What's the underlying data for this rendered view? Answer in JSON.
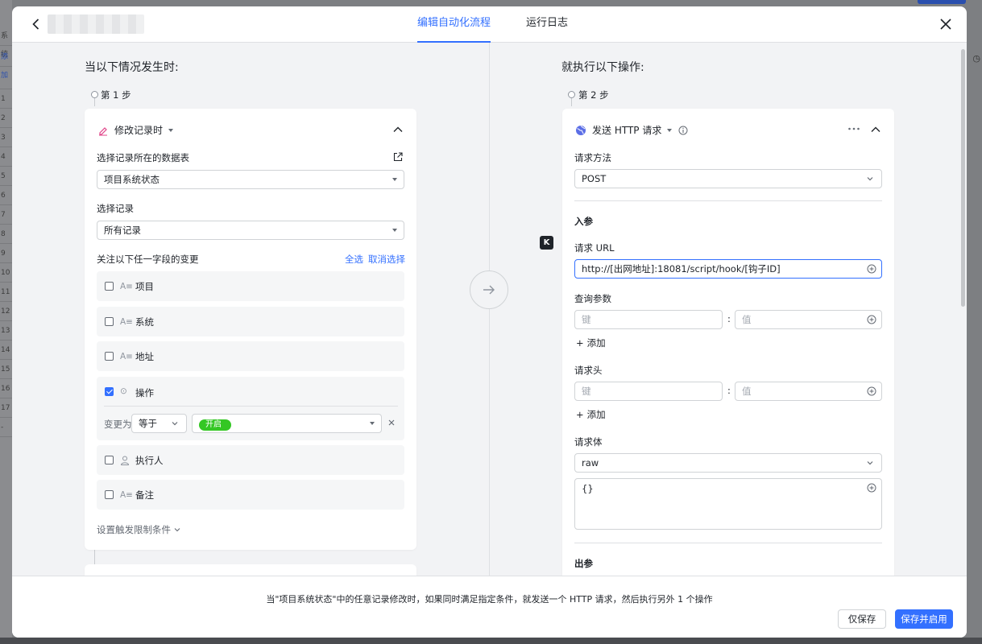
{
  "background": {
    "left_labels": [
      "系统",
      "添加",
      "",
      "1",
      "2",
      "3",
      "4",
      "5",
      "6",
      "7",
      "8",
      "9",
      "10",
      "11",
      "12",
      "13",
      "14",
      "15",
      "16",
      "17",
      "-"
    ]
  },
  "header": {
    "tabs": [
      "编辑自动化流程",
      "运行日志"
    ],
    "active_tab": "编辑自动化流程"
  },
  "trigger": {
    "section_title": "当以下情况发生时:",
    "step": "第 1 步",
    "type_label": "修改记录时",
    "table_label": "选择记录所在的数据表",
    "table_value": "项目系统状态",
    "record_label": "选择记录",
    "record_value": "所有记录",
    "fields_label": "关注以下任一字段的变更",
    "select_all": "全选",
    "deselect": "取消选择",
    "fields": [
      {
        "name": "项目",
        "type": "A≡",
        "checked": false
      },
      {
        "name": "系统",
        "type": "A≡",
        "checked": false
      },
      {
        "name": "地址",
        "type": "A≡",
        "checked": false
      },
      {
        "name": "操作",
        "type": "⊙",
        "checked": true
      },
      {
        "name": "执行人",
        "type": "person",
        "checked": false
      },
      {
        "name": "备注",
        "type": "A≡",
        "checked": false
      }
    ],
    "condition": {
      "prefix": "变更为",
      "operator": "等于",
      "value": "开启"
    },
    "limit_link": "设置触发限制条件"
  },
  "action": {
    "section_title": "就执行以下操作:",
    "step": "第 2 步",
    "type_label": "发送 HTTP 请求",
    "method_label": "请求方法",
    "method_value": "POST",
    "input_params_title": "入参",
    "url_label": "请求 URL",
    "url_value": "http://[出网地址]:18081/script/hook/[钩子ID]",
    "query_label": "查询参数",
    "key_placeholder": "键",
    "value_placeholder": "值",
    "add_label": "添加",
    "headers_label": "请求头",
    "body_label": "请求体",
    "body_type": "raw",
    "body_value": "{}",
    "output_params_title": "出参"
  },
  "k_badge": "K",
  "footer": {
    "description": "当\"项目系统状态\"中的任意记录修改时，如果同时满足指定条件，就发送一个 HTTP 请求，然后执行另外 1 个操作",
    "save_only": "仅保存",
    "save_enable": "保存并启用"
  },
  "colors": {
    "accent": "#3370ff",
    "tag_green": "#34c724",
    "panel_bg": "#f2f3f5"
  }
}
